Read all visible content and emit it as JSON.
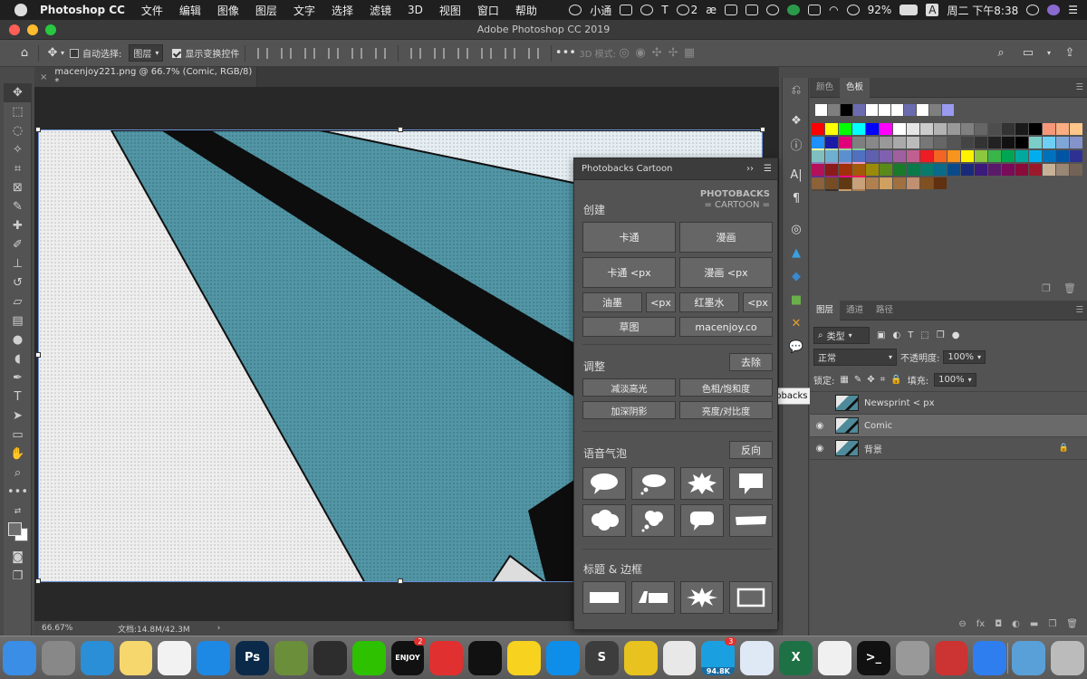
{
  "menubar": {
    "app_name": "Photoshop CC",
    "items": [
      "文件",
      "编辑",
      "图像",
      "图层",
      "文字",
      "选择",
      "滤镜",
      "3D",
      "视图",
      "窗口",
      "帮助"
    ],
    "status_label": "小通",
    "badge_count": "2",
    "battery": "92%",
    "input_method": "A",
    "clock": "周二 下午8:38"
  },
  "window": {
    "title": "Adobe Photoshop CC 2019"
  },
  "options_bar": {
    "auto_select_label": "自动选择:",
    "auto_select_value": "图层",
    "show_transform_label": "显示变换控件",
    "mode_3d_label": "3D 模式:"
  },
  "document": {
    "tab_title": "macenjoy221.png @ 66.7% (Comic, RGB/8) *",
    "zoom": "66.67%",
    "doc_size": "文档:14.8M/42.3M"
  },
  "photobacks": {
    "panel_title": "Photobacks Cartoon",
    "logo_line1": "PHOTOBACKS",
    "logo_line2": "= CARTOON =",
    "create_title": "创建",
    "create_buttons": {
      "cartoon": "卡通",
      "comic": "漫画",
      "cartoon_px": "卡通 <px",
      "comic_px": "漫画 <px",
      "ink": "油墨",
      "ink_px": "<px",
      "red_ink": "红墨水",
      "red_ink_px": "<px",
      "sketch": "草图",
      "site": "macenjoy.co"
    },
    "adjust_title": "调整",
    "adjust_remove": "去除",
    "adjust_buttons": {
      "reduce_highlights": "减淡高光",
      "hue_sat": "色相/饱和度",
      "deepen_shadows": "加深阴影",
      "brightness": "亮度/对比度"
    },
    "bubbles_title": "语音气泡",
    "bubbles_reverse": "反向",
    "titles_title": "标题 & 边框"
  },
  "tooltip": {
    "text": "Photobacks Cartoon"
  },
  "swatches_panel": {
    "tabs": [
      "颜色",
      "色板"
    ],
    "colors_row1": [
      "#ffffff",
      "#7f7f7f",
      "#000000",
      "#6b6bb0",
      "#ffffff",
      "#ffffff",
      "#ffffff",
      "#6b6bb0",
      "#ffffff",
      "#7f7f7f",
      "#9a9af0"
    ],
    "colors_rows": [
      [
        "#ff0000",
        "#ffff00",
        "#00ff00",
        "#00ffff",
        "#0000ff",
        "#ff00ff",
        "#ffffff",
        "#e6e6e6",
        "#cccccc",
        "#b3b3b3",
        "#999999",
        "#808080",
        "#666666",
        "#4d4d4d",
        "#333333",
        "#1a1a1a",
        "#000000",
        "#f7977a",
        "#f9ad81",
        "#fdc68a",
        "#fff79a",
        "#c4df9b",
        "#a2d39c",
        "#82ca9d"
      ],
      [
        "#1e90ff",
        "#1a1aaa",
        "#e0007a",
        "#7f7f7f",
        "#888888",
        "#999999",
        "#aaaaaa",
        "#bbbbbb",
        "#777777",
        "#666666",
        "#555555",
        "#444444",
        "#333333",
        "#222222",
        "#111111",
        "#000000",
        "#7bcdc8",
        "#6ecff6",
        "#7ea7d8",
        "#8493ca",
        "#8882be",
        "#a187be",
        "#bc8dbf",
        "#f49ac2"
      ],
      [
        "#7fbfbf",
        "#6fb0d0",
        "#5a90d0",
        "#5070c0",
        "#6060b0",
        "#8060b0",
        "#a060a0",
        "#c06090",
        "#ee1c24",
        "#f26522",
        "#f7941d",
        "#fff200",
        "#8dc63f",
        "#39b54a",
        "#00a651",
        "#00a99d",
        "#00aeef",
        "#0072bc",
        "#0054a6",
        "#2e3192",
        "#662d91",
        "#92278f",
        "#ec008c",
        "#ed145b"
      ],
      [
        "#b5105a",
        "#8b1a1a",
        "#a0300a",
        "#a05a0a",
        "#9a8a0a",
        "#5a8a1a",
        "#1a7a2a",
        "#0a7a4a",
        "#0a7a6a",
        "#0a6a8a",
        "#0a4a8a",
        "#1a2a7a",
        "#3a1a7a",
        "#5a1a6a",
        "#7a0a5a",
        "#8a0a3a",
        "#9a1a2a",
        "#c7b299",
        "#998675",
        "#736357",
        "#534741",
        "#37302a",
        "#c69c6d",
        "#a67c52"
      ],
      [
        "#8c6239",
        "#754c24",
        "#603913",
        "#c8a07a",
        "#b08050",
        "#d0a060",
        "#a07040",
        "#c09070",
        "#805020",
        "#603010"
      ]
    ]
  },
  "layers_panel": {
    "tabs": [
      "图层",
      "通道",
      "路径"
    ],
    "filter_kind": "类型",
    "blend_mode": "正常",
    "opacity_label": "不透明度:",
    "opacity_value": "100%",
    "lock_label": "锁定:",
    "fill_label": "填充:",
    "fill_value": "100%",
    "layers": [
      {
        "name": "Newsprint < px",
        "visible": false,
        "selected": false,
        "locked": false
      },
      {
        "name": "Comic",
        "visible": true,
        "selected": true,
        "locked": false
      },
      {
        "name": "背景",
        "visible": true,
        "selected": false,
        "locked": true
      }
    ]
  },
  "dock": {
    "apps": [
      {
        "name": "finder-icon",
        "color": "#3a8ee6",
        "label": ""
      },
      {
        "name": "launchpad-icon",
        "color": "#888",
        "label": ""
      },
      {
        "name": "safari-icon",
        "color": "#2a8fd6",
        "label": ""
      },
      {
        "name": "notes-icon",
        "color": "#f5d76e",
        "label": ""
      },
      {
        "name": "music-icon",
        "color": "#f2f2f2",
        "label": ""
      },
      {
        "name": "app-store-icon",
        "color": "#1e88e5",
        "label": ""
      },
      {
        "name": "photoshop-icon",
        "color": "#0b2a4a",
        "label": "Ps"
      },
      {
        "name": "installer-icon",
        "color": "#6b8e3a",
        "label": ""
      },
      {
        "name": "qq-icon",
        "color": "#2d2d2d",
        "label": ""
      },
      {
        "name": "wechat-icon",
        "color": "#2dc100",
        "label": ""
      },
      {
        "name": "enjoy-icon",
        "color": "#111",
        "label": "ENJOY"
      },
      {
        "name": "netease-music-icon",
        "color": "#e03030",
        "label": ""
      },
      {
        "name": "infuse-icon",
        "color": "#111",
        "label": ""
      },
      {
        "name": "qq-music-icon",
        "color": "#f7d21e",
        "label": ""
      },
      {
        "name": "teamviewer-icon",
        "color": "#0e8ee9",
        "label": ""
      },
      {
        "name": "sublime-icon",
        "color": "#3d3d3d",
        "label": "S"
      },
      {
        "name": "transmit-icon",
        "color": "#e8c21e",
        "label": ""
      },
      {
        "name": "chrome-icon",
        "color": "#e8e8e8",
        "label": ""
      },
      {
        "name": "downloader-icon",
        "color": "#1aa0e0",
        "label": ""
      },
      {
        "name": "icloud-icon",
        "color": "#dfe8f5",
        "label": ""
      },
      {
        "name": "excel-icon",
        "color": "#1e7145",
        "label": "X"
      },
      {
        "name": "textedit-icon",
        "color": "#f0f0f0",
        "label": ""
      },
      {
        "name": "terminal-icon",
        "color": "#111",
        "label": ">_"
      },
      {
        "name": "disk-utility-icon",
        "color": "#999",
        "label": ""
      },
      {
        "name": "parallels-icon",
        "color": "#c33",
        "label": ""
      },
      {
        "name": "baidu-pan-icon",
        "color": "#2f7ef0",
        "label": ""
      },
      {
        "name": "downloads-folder-icon",
        "color": "#5aa0d8",
        "label": ""
      },
      {
        "name": "trash-icon",
        "color": "#bbb",
        "label": ""
      }
    ],
    "badges": {
      "enjoy-icon": "2",
      "downloader-icon": "3"
    },
    "downloader_label": "94.8K"
  }
}
